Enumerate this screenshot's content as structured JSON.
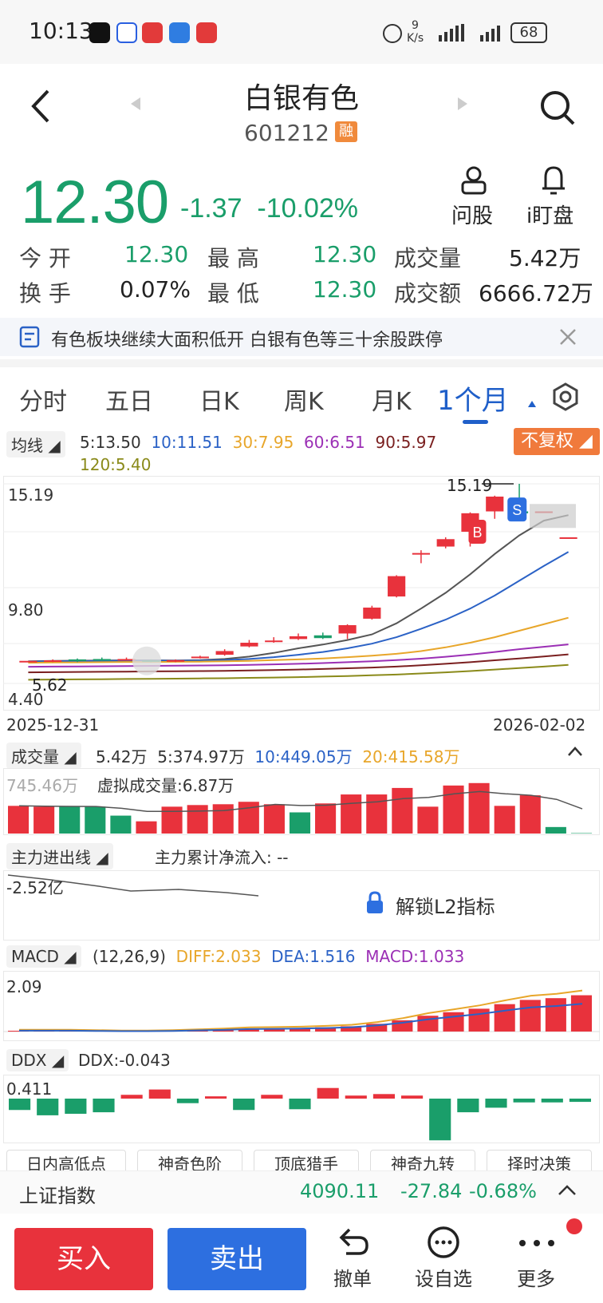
{
  "status": {
    "time": "10:13",
    "net_speed": "9",
    "net_unit": "K/s",
    "battery": "68"
  },
  "header": {
    "title": "白银有色",
    "code": "601212",
    "margin_badge": "融"
  },
  "quote": {
    "price": "12.30",
    "change": "-1.37",
    "change_pct": "-10.02%",
    "actions": [
      {
        "label": "问股",
        "icon": "person-icon"
      },
      {
        "label": "i盯盘",
        "icon": "bell-icon"
      }
    ],
    "rows": [
      [
        {
          "label": "今  开",
          "value": "12.30"
        },
        {
          "label": "最  高",
          "value": "12.30"
        },
        {
          "label": "成交量",
          "value": "5.42万"
        }
      ],
      [
        {
          "label": "换  手",
          "value": "0.07%"
        },
        {
          "label": "最  低",
          "value": "12.30"
        },
        {
          "label": "成交额",
          "value": "6666.72万"
        }
      ]
    ]
  },
  "news": {
    "text": "有色板块继续大面积低开 白银有色等三十余股跌停"
  },
  "tabs": [
    {
      "label": "分时"
    },
    {
      "label": "五日"
    },
    {
      "label": "日K"
    },
    {
      "label": "周K"
    },
    {
      "label": "月K"
    },
    {
      "label": "1个月",
      "active": true
    }
  ],
  "ma": {
    "button": "均线",
    "items": [
      {
        "text": "5:13.50",
        "color": "#333333"
      },
      {
        "text": "10:11.51",
        "color": "#2b62c6"
      },
      {
        "text": "30:7.95",
        "color": "#e8a62a"
      },
      {
        "text": "60:6.51",
        "color": "#9b2fb5"
      },
      {
        "text": "90:5.97",
        "color": "#7a1f1f"
      },
      {
        "text": "120:5.40",
        "color": "#8a8a1a"
      }
    ],
    "adjust": "不复权"
  },
  "kline": {
    "y_top": "15.19",
    "y_mid": "9.80",
    "y_low": "4.40",
    "low_mark": "5.62",
    "high_mark": "15.19",
    "date_start": "2025-12-31",
    "date_end": "2026-02-02",
    "buy_tag": "B",
    "sell_tag": "S"
  },
  "volume": {
    "label": "成交量",
    "v": "5.42万",
    "ma5": "5:374.97万",
    "ma10": "10:449.05万",
    "ma20": "20:415.58万",
    "axis": "745.46万",
    "virtual": "虚拟成交量:6.87万"
  },
  "mainflow": {
    "label": "主力进出线",
    "sub": "主力累计净流入: --",
    "axis": "-2.52亿",
    "unlock": "解锁L2指标"
  },
  "macd": {
    "label": "MACD",
    "params": "(12,26,9)",
    "diff": "DIFF:2.033",
    "dea": "DEA:1.516",
    "macd": "MACD:1.033",
    "axis": "2.09"
  },
  "ddx": {
    "label": "DDX",
    "value": "DDX:-0.043",
    "axis": "0.411"
  },
  "chips": [
    "日内高低点",
    "神奇色阶",
    "顶底猎手",
    "神奇九转",
    "择时决策"
  ],
  "index": {
    "name": "上证指数",
    "value": "4090.11",
    "change": "-27.84",
    "pct": "-0.68%"
  },
  "bottom": {
    "buy": "买入",
    "sell": "卖出",
    "nav": [
      {
        "label": "撤单"
      },
      {
        "label": "设自选"
      },
      {
        "label": "更多"
      }
    ]
  },
  "chart_data": [
    {
      "type": "candlestick",
      "title": "",
      "ylim": [
        4.4,
        15.19
      ],
      "candles": [
        {
          "o": 5.62,
          "c": 5.62,
          "h": 5.62,
          "l": 5.62
        },
        {
          "o": 5.6,
          "c": 5.65,
          "h": 5.7,
          "l": 5.55
        },
        {
          "o": 5.7,
          "c": 5.62,
          "h": 5.75,
          "l": 5.55
        },
        {
          "o": 5.72,
          "c": 5.68,
          "h": 5.8,
          "l": 5.62
        },
        {
          "o": 5.7,
          "c": 5.72,
          "h": 5.8,
          "l": 5.65
        },
        {
          "o": 5.65,
          "c": 5.6,
          "h": 5.7,
          "l": 5.55
        },
        {
          "o": 5.6,
          "c": 5.66,
          "h": 5.7,
          "l": 5.55
        },
        {
          "o": 5.8,
          "c": 5.85,
          "h": 5.9,
          "l": 5.75
        },
        {
          "o": 5.95,
          "c": 6.15,
          "h": 6.25,
          "l": 5.9
        },
        {
          "o": 6.4,
          "c": 6.6,
          "h": 6.75,
          "l": 6.35
        },
        {
          "o": 6.7,
          "c": 6.72,
          "h": 6.9,
          "l": 6.6
        },
        {
          "o": 6.8,
          "c": 6.95,
          "h": 7.1,
          "l": 6.75
        },
        {
          "o": 7.0,
          "c": 6.85,
          "h": 7.15,
          "l": 6.8
        },
        {
          "o": 7.1,
          "c": 7.55,
          "h": 7.6,
          "l": 6.8
        },
        {
          "o": 7.9,
          "c": 8.5,
          "h": 8.6,
          "l": 7.85
        },
        {
          "o": 9.1,
          "c": 10.2,
          "h": 10.25,
          "l": 9.05
        },
        {
          "o": 11.4,
          "c": 11.45,
          "h": 11.6,
          "l": 10.9
        },
        {
          "o": 11.8,
          "c": 12.2,
          "h": 12.3,
          "l": 11.7
        },
        {
          "o": 12.6,
          "c": 13.6,
          "h": 13.65,
          "l": 11.8
        },
        {
          "o": 13.7,
          "c": 14.5,
          "h": 14.55,
          "l": 13.3
        },
        {
          "o": 13.7,
          "c": 13.6,
          "h": 15.19,
          "l": 13.55
        },
        {
          "o": 13.7,
          "c": 13.7,
          "h": 13.7,
          "l": 13.7
        },
        {
          "o": 12.3,
          "c": 12.3,
          "h": 12.3,
          "l": 12.3
        }
      ],
      "series": [
        {
          "name": "5",
          "color": "#555555",
          "values": [
            5.6,
            5.62,
            5.63,
            5.64,
            5.65,
            5.65,
            5.64,
            5.66,
            5.72,
            5.85,
            6.05,
            6.3,
            6.5,
            6.75,
            7.05,
            7.65,
            8.45,
            9.3,
            10.3,
            11.4,
            12.4,
            13.2,
            13.5
          ]
        },
        {
          "name": "10",
          "color": "#2b62c6",
          "values": [
            5.58,
            5.6,
            5.61,
            5.62,
            5.63,
            5.63,
            5.63,
            5.64,
            5.66,
            5.72,
            5.82,
            5.95,
            6.1,
            6.3,
            6.55,
            6.9,
            7.35,
            7.85,
            8.45,
            9.15,
            9.95,
            10.75,
            11.51
          ]
        },
        {
          "name": "30",
          "color": "#e8a62a",
          "values": [
            5.52,
            5.53,
            5.54,
            5.55,
            5.56,
            5.56,
            5.57,
            5.58,
            5.6,
            5.62,
            5.66,
            5.7,
            5.75,
            5.82,
            5.9,
            6.0,
            6.15,
            6.35,
            6.6,
            6.9,
            7.25,
            7.6,
            7.95
          ]
        },
        {
          "name": "60",
          "color": "#9b2fb5",
          "values": [
            5.3,
            5.31,
            5.32,
            5.33,
            5.34,
            5.35,
            5.36,
            5.37,
            5.38,
            5.4,
            5.43,
            5.46,
            5.5,
            5.55,
            5.6,
            5.66,
            5.74,
            5.84,
            5.96,
            6.1,
            6.25,
            6.38,
            6.51
          ]
        },
        {
          "name": "90",
          "color": "#7a1f1f",
          "values": [
            5.0,
            5.01,
            5.02,
            5.03,
            5.04,
            5.05,
            5.06,
            5.07,
            5.08,
            5.1,
            5.12,
            5.15,
            5.18,
            5.22,
            5.26,
            5.31,
            5.38,
            5.46,
            5.55,
            5.65,
            5.75,
            5.86,
            5.97
          ]
        },
        {
          "name": "120",
          "color": "#8a8a1a",
          "values": [
            4.6,
            4.61,
            4.62,
            4.63,
            4.64,
            4.65,
            4.66,
            4.67,
            4.68,
            4.7,
            4.72,
            4.74,
            4.77,
            4.8,
            4.84,
            4.88,
            4.94,
            5.0,
            5.07,
            5.15,
            5.23,
            5.31,
            5.4
          ]
        }
      ]
    },
    {
      "type": "bar",
      "title": "成交量",
      "ylim": [
        0,
        745.46
      ],
      "values": [
        340,
        330,
        330,
        330,
        220,
        150,
        330,
        350,
        360,
        390,
        360,
        260,
        370,
        480,
        480,
        560,
        330,
        590,
        620,
        340,
        470,
        80,
        5.42
      ],
      "colors": [
        "red",
        "red",
        "green",
        "green",
        "green",
        "red",
        "red",
        "red",
        "red",
        "red",
        "red",
        "green",
        "red",
        "red",
        "red",
        "red",
        "red",
        "red",
        "red",
        "red",
        "red",
        "green",
        "green"
      ]
    },
    {
      "type": "bar",
      "title": "MACD",
      "values": [
        0.02,
        0.02,
        0.02,
        0.01,
        0.0,
        0.0,
        0.01,
        0.03,
        0.05,
        0.08,
        0.09,
        0.1,
        0.12,
        0.15,
        0.22,
        0.32,
        0.45,
        0.55,
        0.65,
        0.78,
        0.9,
        0.95,
        1.033
      ]
    },
    {
      "type": "bar",
      "title": "DDX",
      "values": [
        -0.15,
        -0.22,
        -0.2,
        -0.18,
        0.05,
        0.12,
        -0.06,
        0.03,
        -0.15,
        0.05,
        -0.14,
        0.14,
        0.04,
        0.06,
        0.04,
        -0.55,
        -0.18,
        -0.12,
        -0.05,
        -0.05,
        -0.043
      ]
    }
  ]
}
